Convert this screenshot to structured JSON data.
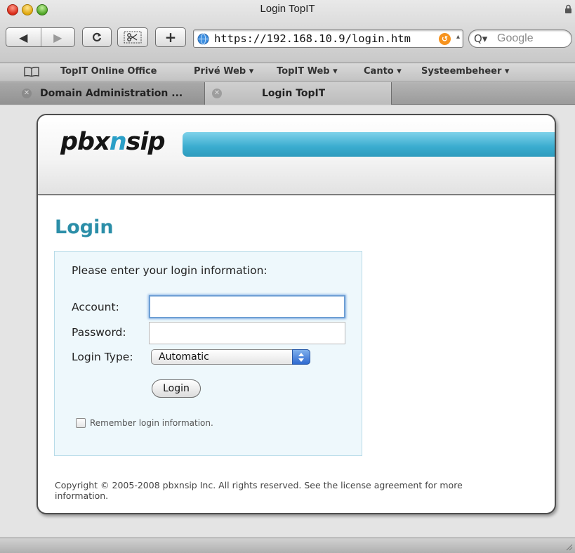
{
  "window": {
    "title": "Login TopIT"
  },
  "toolbar": {
    "back_label": "◀",
    "forward_label": "▶",
    "reload_label": "c",
    "plus_label": "+",
    "url": "https://192.168.10.9/login.htm",
    "search_placeholder": "Google",
    "search_prefix": "Q▾"
  },
  "bookmarks": [
    {
      "label": "TopIT Online Office"
    },
    {
      "label": "Privé Web ▾"
    },
    {
      "label": "TopIT Web ▾"
    },
    {
      "label": "Canto ▾"
    },
    {
      "label": "Systeembeheer ▾"
    }
  ],
  "tabs": [
    {
      "label": "Domain Administration ...",
      "active": false
    },
    {
      "label": "Login TopIT",
      "active": true
    }
  ],
  "page": {
    "logo_pre": "pbx",
    "logo_n": "n",
    "logo_post": "sip",
    "heading": "Login",
    "intro": "Please enter your login information:",
    "account_label": "Account:",
    "account_value": "",
    "password_label": "Password:",
    "password_value": "",
    "login_type_label": "Login Type:",
    "login_type_value": "Automatic",
    "login_button": "Login",
    "remember_label": "Remember login information.",
    "remember_checked": false,
    "copyright": "Copyright © 2005-2008 pbxnsip Inc. All rights reserved. See the license agreement for more information."
  },
  "colors": {
    "accent": "#2b8ea8",
    "logo_n": "#2a9fc7",
    "stripe": "#3aaccf",
    "login_box_bg": "#eef8fc"
  }
}
